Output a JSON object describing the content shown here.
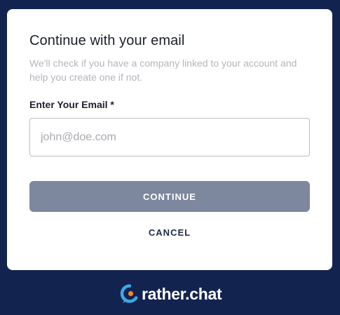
{
  "dialog": {
    "title": "Continue with your email",
    "subtitle": "We'll check if you have a company linked to your account and help you create one if not.",
    "email_label": "Enter Your Email *",
    "email_value": "",
    "email_placeholder": "john@doe.com",
    "continue_label": "CONTINUE",
    "cancel_label": "CANCEL"
  },
  "footer": {
    "brand_name": "rather.chat",
    "logo_icon": "rather-chat-logo-icon"
  },
  "colors": {
    "page_background": "#13234f",
    "card_background": "#ffffff",
    "primary_button": "#7d879d",
    "cancel_text": "#1b2a4f",
    "logo_blue": "#3fa7e6",
    "logo_orange": "#f5822a"
  }
}
